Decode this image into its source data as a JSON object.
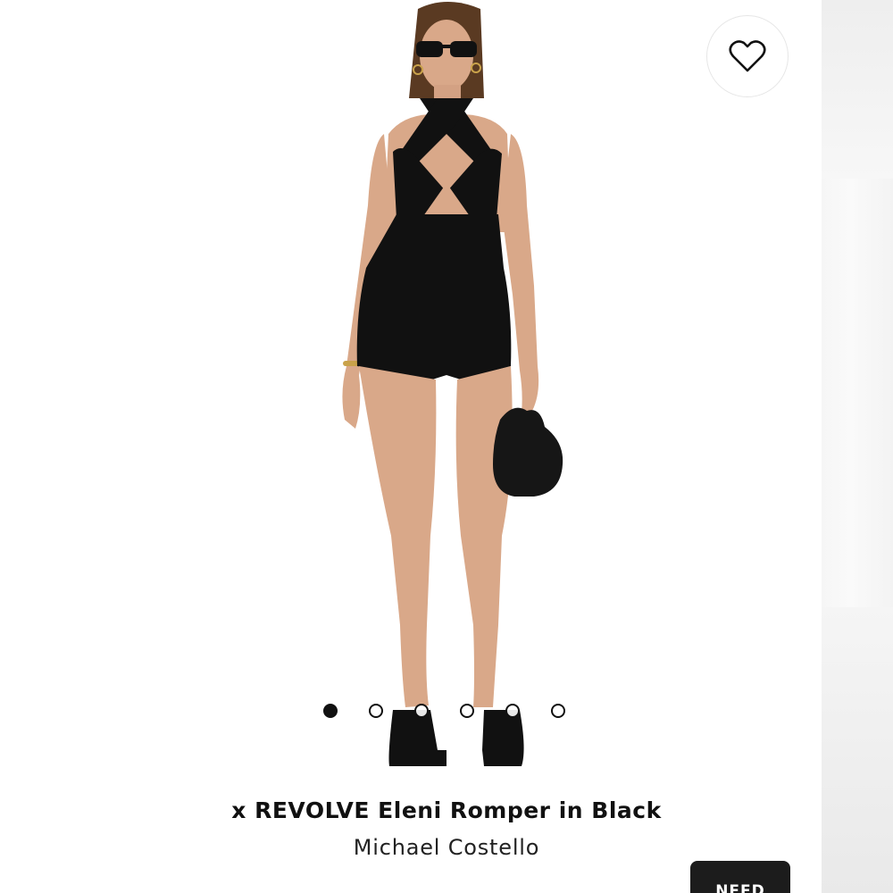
{
  "product": {
    "title": "x REVOLVE Eleni Romper in Black",
    "brand": "Michael Costello"
  },
  "gallery": {
    "image_count": 6,
    "active_index": 0
  },
  "wishlist": {
    "icon": "heart-outline-icon"
  },
  "help_button": {
    "label": "NEED"
  },
  "colors": {
    "garment": "#111111",
    "skin": "#d9a889",
    "button_bg": "#1c1c1c",
    "text": "#111111"
  }
}
